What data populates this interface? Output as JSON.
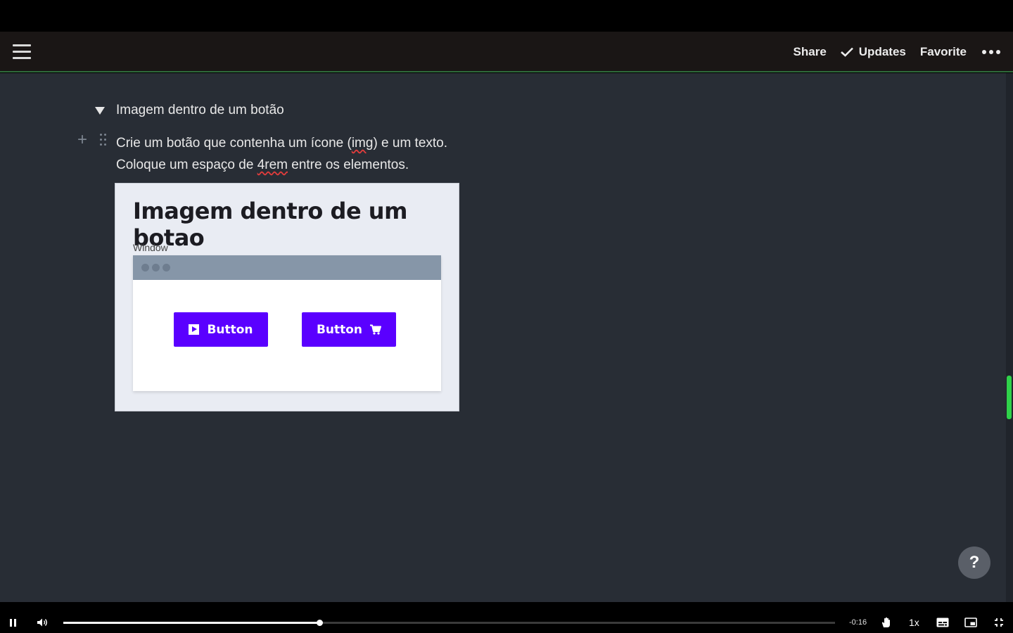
{
  "header": {
    "share_label": "Share",
    "updates_label": "Updates",
    "favorite_label": "Favorite"
  },
  "document": {
    "toggle_title": "Imagem dentro de um botão",
    "paragraph": {
      "line1_a": "Crie um botão que contenha um ícone (",
      "line1_squiggle": "img",
      "line1_b": ") e um texto.",
      "line2_a": "Coloque um espaço de ",
      "line2_squiggle": "4rem",
      "line2_b": " entre os elementos."
    },
    "embedded_image": {
      "heading": "Imagem dentro de um botao",
      "window_label": "Window",
      "button_left_label": "Button",
      "button_right_label": "Button",
      "button_color": "#5a00ff"
    }
  },
  "help_label": "?",
  "player": {
    "progress_fraction": 0.332,
    "time_remaining": "-0:16",
    "speed": "1x"
  },
  "colors": {
    "content_bg": "#282d35",
    "header_bg": "#1a1615",
    "accent_green": "#2fd24a"
  }
}
